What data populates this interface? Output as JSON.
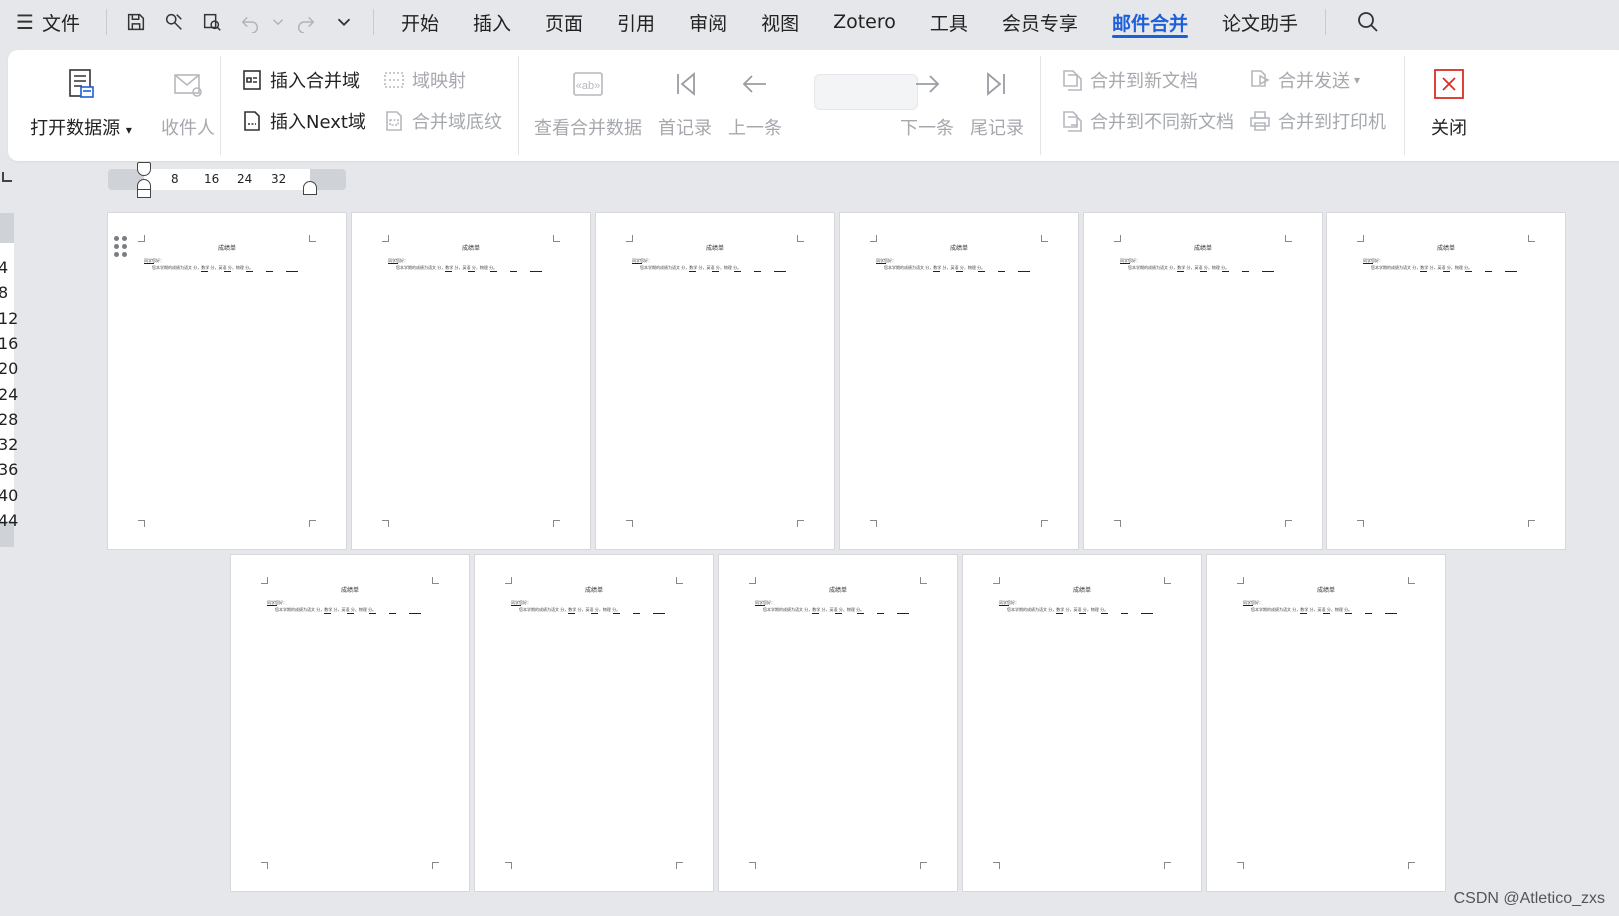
{
  "menubar": {
    "file": "文件",
    "tabs": [
      "开始",
      "插入",
      "页面",
      "引用",
      "审阅",
      "视图",
      "Zotero",
      "工具",
      "会员专享",
      "邮件合并",
      "论文助手"
    ],
    "active_tab": "邮件合并"
  },
  "ribbon": {
    "open_source": "打开数据源",
    "recipients": "收件人",
    "insert_merge_field": "插入合并域",
    "field_mapping": "域映射",
    "insert_next_field": "插入Next域",
    "merge_field_shading": "合并域底纹",
    "view_merged_data": "查看合并数据",
    "first_record": "首记录",
    "prev_record": "上一条",
    "next_record": "下一条",
    "last_record": "尾记录",
    "merge_to_new_doc": "合并到新文档",
    "merge_send": "合并发送",
    "merge_to_separate_docs": "合并到不同新文档",
    "merge_to_printer": "合并到打印机",
    "close": "关闭"
  },
  "ruler": {
    "h_ticks": [
      "8",
      "16",
      "24",
      "32"
    ],
    "v_ticks": [
      "4",
      "8",
      "12",
      "16",
      "20",
      "24",
      "28",
      "32",
      "36",
      "40",
      "44"
    ]
  },
  "pages": {
    "title": "成绩单",
    "line1": "同学您好：",
    "line2": "您本学期的成绩为语文  分，数学  分，英语  分，物理  分。"
  },
  "watermark": "CSDN @Atletico_zxs"
}
